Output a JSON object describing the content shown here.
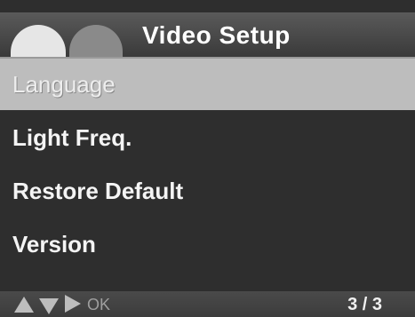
{
  "header": {
    "title": "Video Setup",
    "tabs": [
      "tab-active",
      "tab-inactive"
    ]
  },
  "menu": {
    "items": [
      {
        "label": "Language",
        "selected": true
      },
      {
        "label": "Light Freq.",
        "selected": false
      },
      {
        "label": "Restore Default",
        "selected": false
      },
      {
        "label": "Version",
        "selected": false
      }
    ]
  },
  "footer": {
    "icons": [
      "up-arrow-icon",
      "down-arrow-icon",
      "right-arrow-icon"
    ],
    "ok_label": "OK",
    "page_indicator": "3 / 3"
  },
  "colors": {
    "selected_bg": "#bdbdbd",
    "menu_bg": "#2e2e2e",
    "header_bg": "#4a4a4a",
    "text": "#f4f4f4"
  }
}
